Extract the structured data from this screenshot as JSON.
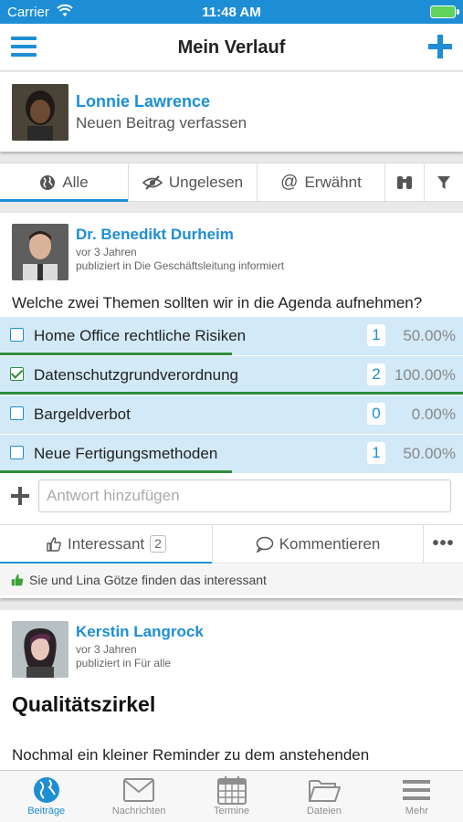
{
  "status_bar": {
    "carrier": "Carrier",
    "time": "11:48 AM"
  },
  "navbar": {
    "title": "Mein Verlauf"
  },
  "composer": {
    "user_name": "Lonnie Lawrence",
    "prompt": "Neuen Beitrag verfassen"
  },
  "filters": [
    {
      "label": "Alle",
      "icon": "globe-icon",
      "active": true
    },
    {
      "label": "Ungelesen",
      "icon": "eye-slash-icon"
    },
    {
      "label": "Erwähnt",
      "icon": "at-icon"
    },
    {
      "label": "",
      "icon": "binoculars-icon"
    },
    {
      "label": "",
      "icon": "filter-icon"
    }
  ],
  "post1": {
    "author": "Dr. Benedikt Durheim",
    "time": "vor 3 Jahren",
    "published": "publiziert in Die Geschäftsleitung informiert",
    "question": "Welche zwei Themen sollten wir in die Agenda aufnehmen?",
    "poll": [
      {
        "label": "Home Office rechtliche Risiken",
        "count": "1",
        "percent": "50.00%",
        "fraction": 0.5,
        "checked": false
      },
      {
        "label": "Datenschutzgrundverordnung",
        "count": "2",
        "percent": "100.00%",
        "fraction": 1.0,
        "checked": true
      },
      {
        "label": "Bargeldverbot",
        "count": "0",
        "percent": "0.00%",
        "fraction": 0.0,
        "checked": false
      },
      {
        "label": "Neue Fertigungsmethoden",
        "count": "1",
        "percent": "50.00%",
        "fraction": 0.5,
        "checked": false
      }
    ],
    "answer_placeholder": "Antwort hinzufügen",
    "actions": {
      "like_label": "Interessant",
      "like_count": "2",
      "comment_label": "Kommentieren"
    },
    "likes_text": "Sie und Lina Götze finden das interessant"
  },
  "post2": {
    "author": "Kerstin Langrock",
    "time": "vor 3 Jahren",
    "published": "publiziert in Für alle",
    "headline": "Qualitätszirkel",
    "body": "Nochmal ein kleiner Reminder zu dem anstehenden"
  },
  "tabbar": [
    {
      "label": "Beiträge",
      "icon": "globe-icon",
      "active": true
    },
    {
      "label": "Nachrichten",
      "icon": "envelope-icon"
    },
    {
      "label": "Termine",
      "icon": "calendar-icon"
    },
    {
      "label": "Dateien",
      "icon": "folder-icon"
    },
    {
      "label": "Mehr",
      "icon": "menu-icon"
    }
  ],
  "colors": {
    "accent": "#1d8ed6",
    "poll_bg": "#d2e9f7",
    "poll_bar": "#2d8c3c",
    "like_green": "#3aa13a"
  }
}
